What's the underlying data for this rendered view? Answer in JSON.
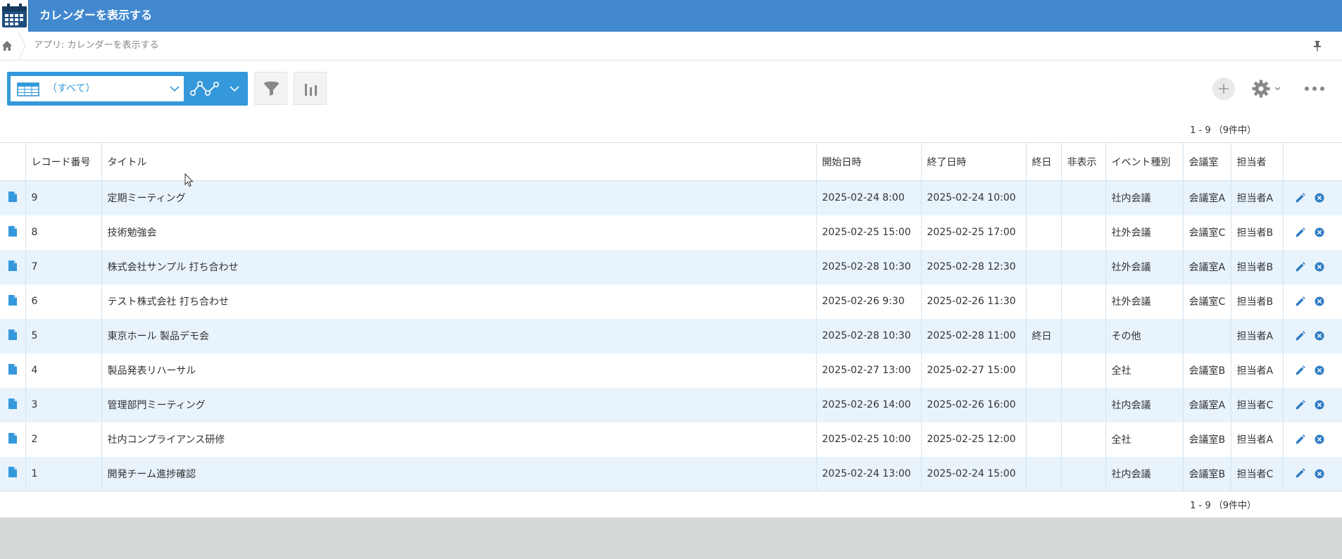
{
  "header": {
    "title": "カレンダーを表示する",
    "icon": "calendar-icon"
  },
  "breadcrumb": {
    "home_icon": "home-icon",
    "text": "アプリ: カレンダーを表示する",
    "pin_icon": "pin-icon"
  },
  "toolbar": {
    "view_label": "（すべて）",
    "view_icon": "table-icon",
    "graph_icon": "graph-icon",
    "filter_icon": "filter-icon",
    "chart_icon": "bar-chart-icon",
    "add_icon": "plus-icon",
    "settings_icon": "gear-icon",
    "more_icon": "more-icon"
  },
  "pager": {
    "top": "1 - 9 （9件中）",
    "bottom": "1 - 9 （9件中）"
  },
  "table": {
    "columns": [
      "",
      "レコード番号",
      "タイトル",
      "開始日時",
      "終了日時",
      "終日",
      "非表示",
      "イベント種別",
      "会議室",
      "担当者",
      ""
    ],
    "rows": [
      {
        "id": "9",
        "title": "定期ミーティング",
        "start": "2025-02-24 8:00",
        "end": "2025-02-24 10:00",
        "allday": "",
        "hidden": "",
        "type": "社内会議",
        "room": "会議室A",
        "owner": "担当者A"
      },
      {
        "id": "8",
        "title": "技術勉強会",
        "start": "2025-02-25 15:00",
        "end": "2025-02-25 17:00",
        "allday": "",
        "hidden": "",
        "type": "社外会議",
        "room": "会議室C",
        "owner": "担当者B"
      },
      {
        "id": "7",
        "title": "株式会社サンプル 打ち合わせ",
        "start": "2025-02-28 10:30",
        "end": "2025-02-28 12:30",
        "allday": "",
        "hidden": "",
        "type": "社外会議",
        "room": "会議室A",
        "owner": "担当者B"
      },
      {
        "id": "6",
        "title": "テスト株式会社 打ち合わせ",
        "start": "2025-02-26 9:30",
        "end": "2025-02-26 11:30",
        "allday": "",
        "hidden": "",
        "type": "社外会議",
        "room": "会議室C",
        "owner": "担当者B"
      },
      {
        "id": "5",
        "title": "東京ホール 製品デモ会",
        "start": "2025-02-28 10:30",
        "end": "2025-02-28 11:00",
        "allday": "終日",
        "hidden": "",
        "type": "その他",
        "room": "",
        "owner": "担当者A"
      },
      {
        "id": "4",
        "title": "製品発表リハーサル",
        "start": "2025-02-27 13:00",
        "end": "2025-02-27 15:00",
        "allday": "",
        "hidden": "",
        "type": "全社",
        "room": "会議室B",
        "owner": "担当者A"
      },
      {
        "id": "3",
        "title": "管理部門ミーティング",
        "start": "2025-02-26 14:00",
        "end": "2025-02-26 16:00",
        "allday": "",
        "hidden": "",
        "type": "社内会議",
        "room": "会議室A",
        "owner": "担当者C"
      },
      {
        "id": "2",
        "title": "社内コンプライアンス研修",
        "start": "2025-02-25 10:00",
        "end": "2025-02-25 12:00",
        "allday": "",
        "hidden": "",
        "type": "全社",
        "room": "会議室B",
        "owner": "担当者A"
      },
      {
        "id": "1",
        "title": "開発チーム進捗確認",
        "start": "2025-02-24 13:00",
        "end": "2025-02-24 15:00",
        "allday": "",
        "hidden": "",
        "type": "社内会議",
        "room": "会議室B",
        "owner": "担当者C"
      }
    ]
  },
  "colors": {
    "header": "#4188ce",
    "accent": "#3498db",
    "row_alt": "#e8f3fc"
  }
}
